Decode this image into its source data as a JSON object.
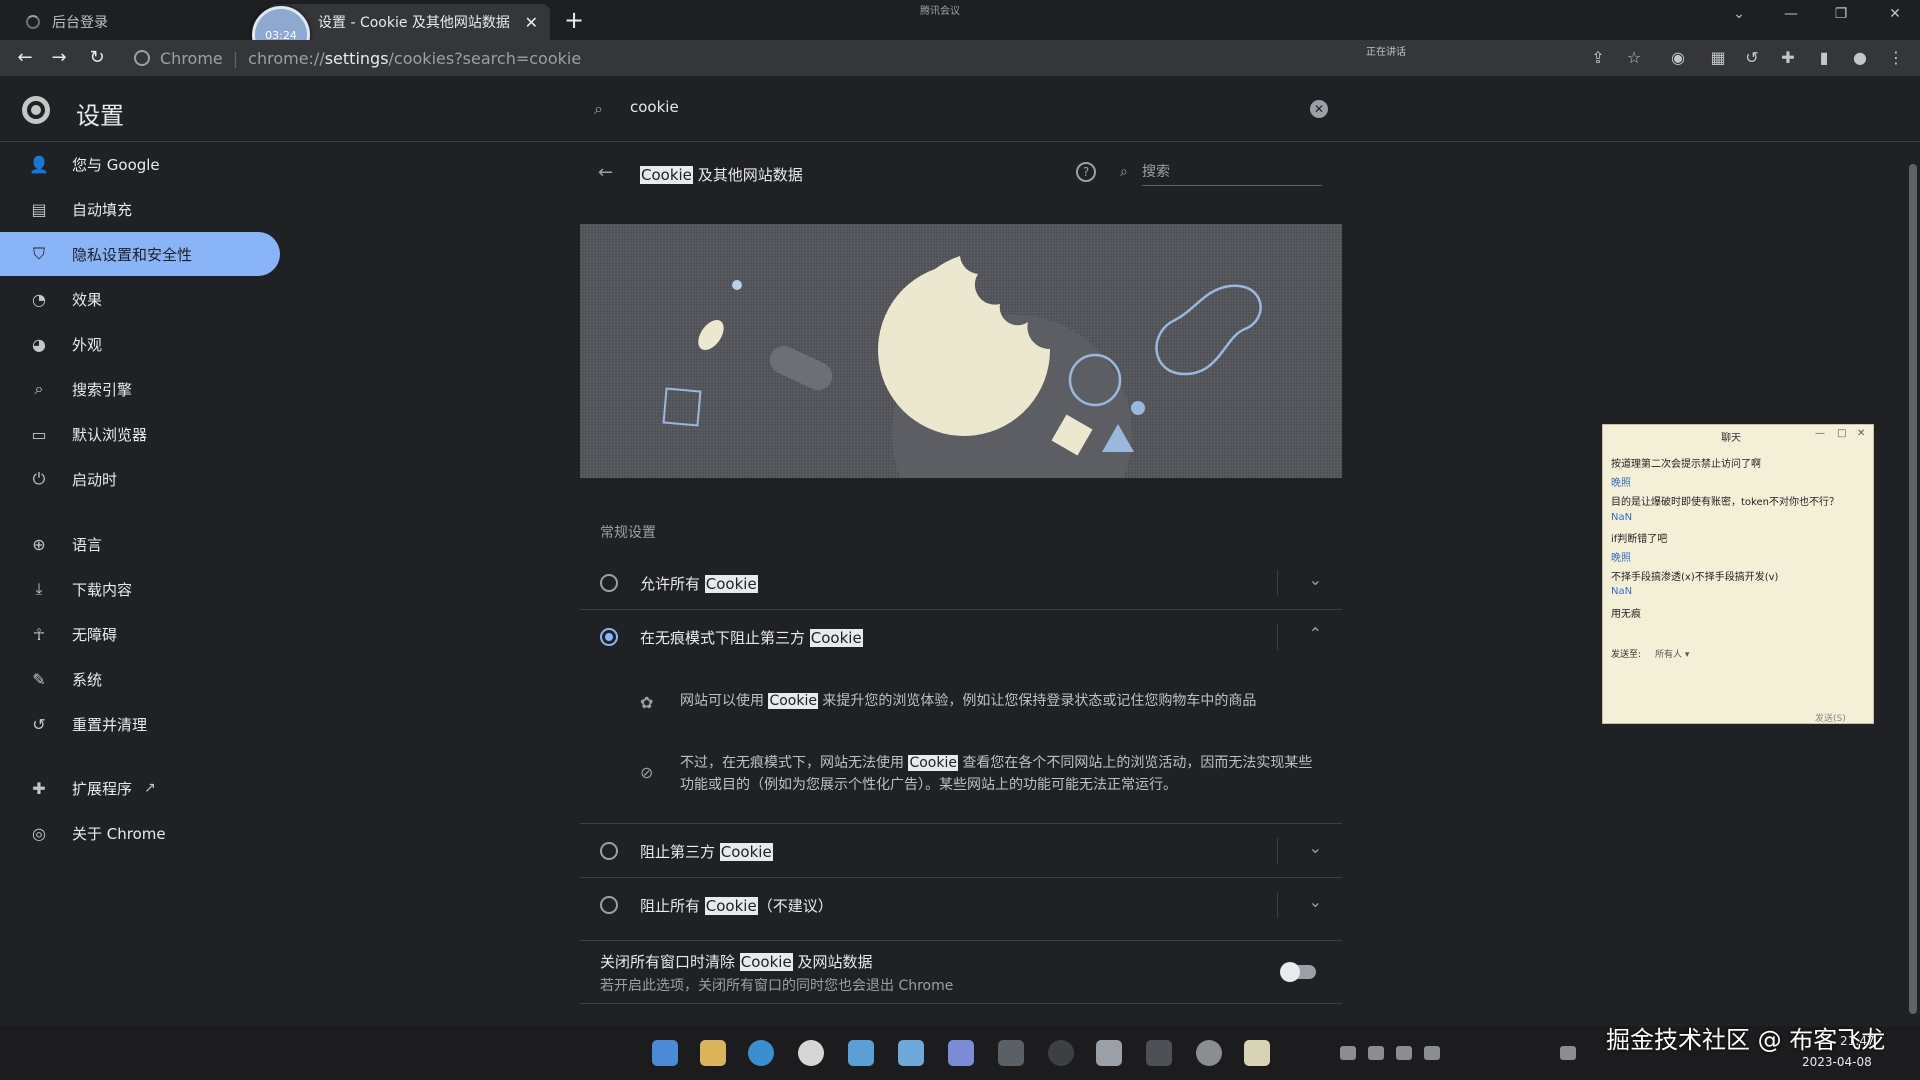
{
  "tabs": [
    {
      "title": "后台登录",
      "active": false
    },
    {
      "title": "设置 - Cookie 及其他网站数据",
      "active": true
    }
  ],
  "recording_badge": "03:24",
  "top_center_text": "腾讯会议",
  "toolbar": {
    "site_label": "Chrome",
    "url_prefix": "chrome://",
    "url_path": "settings",
    "url_rest": "/cookies?search=cookie",
    "sharing_text": "正在讲话"
  },
  "settings": {
    "title": "设置",
    "search_value": "cookie"
  },
  "sidebar": {
    "items": [
      {
        "label": "您与 Google",
        "icon": "person-icon"
      },
      {
        "label": "自动填充",
        "icon": "clipboard-icon"
      },
      {
        "label": "隐私设置和安全性",
        "icon": "shield-icon",
        "selected": true
      },
      {
        "label": "效果",
        "icon": "gauge-icon"
      },
      {
        "label": "外观",
        "icon": "palette-icon"
      },
      {
        "label": "搜索引擎",
        "icon": "search-icon"
      },
      {
        "label": "默认浏览器",
        "icon": "browser-icon"
      },
      {
        "label": "启动时",
        "icon": "power-icon"
      },
      {
        "label": "语言",
        "icon": "globe-icon"
      },
      {
        "label": "下载内容",
        "icon": "download-icon"
      },
      {
        "label": "无障碍",
        "icon": "accessibility-icon"
      },
      {
        "label": "系统",
        "icon": "wrench-icon"
      },
      {
        "label": "重置并清理",
        "icon": "restore-icon"
      },
      {
        "label": "扩展程序",
        "icon": "puzzle-icon"
      },
      {
        "label": "关于 Chrome",
        "icon": "chrome-icon"
      }
    ]
  },
  "subpage": {
    "title_hl": "Cookie",
    "title_rest": " 及其他网站数据",
    "search_placeholder": "搜索"
  },
  "general": {
    "section_label": "常规设置",
    "options": [
      {
        "pre": "允许所有 ",
        "hl": "Cookie",
        "post": "",
        "checked": false
      },
      {
        "pre": "在无痕模式下阻止第三方 ",
        "hl": "Cookie",
        "post": "",
        "checked": true
      },
      {
        "pre": "阻止第三方 ",
        "hl": "Cookie",
        "post": "",
        "checked": false
      },
      {
        "pre": "阻止所有 ",
        "hl": "Cookie",
        "post": "（不建议）",
        "checked": false
      }
    ],
    "detail1": {
      "pre": "网站可以使用 ",
      "hl": "Cookie",
      "post": " 来提升您的浏览体验，例如让您保持登录状态或记住您购物车中的商品"
    },
    "detail2": {
      "pre": "不过，在无痕模式下，网站无法使用 ",
      "hl": "Cookie",
      "post": " 查看您在各个不同网站上的浏览活动，因而无法实现某些功能或目的（例如为您展示个性化广告）。某些网站上的功能可能无法正常运行。"
    },
    "toggle": {
      "pre": "关闭所有窗口时清除 ",
      "hl": "Cookie",
      "post": " 及网站数据",
      "sub": "若开启此选项，关闭所有窗口的同时您也会退出 Chrome",
      "on": false
    }
  },
  "chat": {
    "title": "聊天",
    "lines": [
      {
        "text": "按道理第二次会提示禁止访问了啊",
        "name": false
      },
      {
        "text": "晚照",
        "name": true
      },
      {
        "text": "目的是让爆破时即使有账密，token不对你也不行？",
        "name": false
      },
      {
        "text": "NaN",
        "name": true
      },
      {
        "text": "if判断错了吧",
        "name": false
      },
      {
        "text": "晚照",
        "name": true
      },
      {
        "text": "不择手段搞渗透(x)不择手段搞开发(v)",
        "name": false
      },
      {
        "text": "NaN",
        "name": true
      },
      {
        "text": "用无痕",
        "name": false
      }
    ],
    "send_to_label": "发送至:",
    "send_to_value": "所有人 ▾",
    "send_label": "发送(S)"
  },
  "watermark": "掘金技术社区 @ 布客飞龙",
  "clock": {
    "time": "21:47",
    "date": "2023-04-08"
  }
}
